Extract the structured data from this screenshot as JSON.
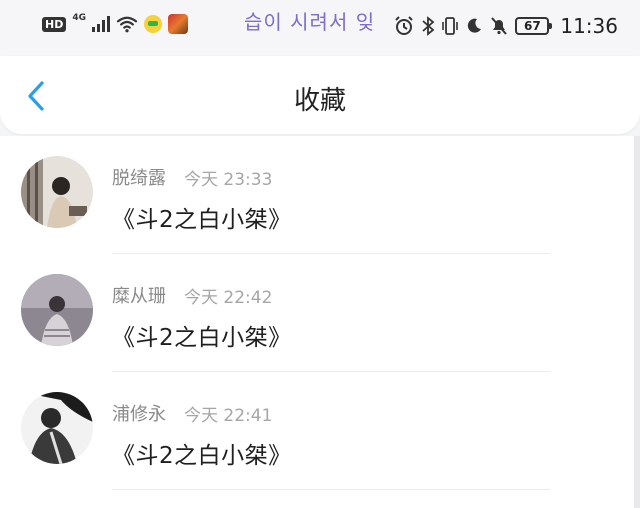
{
  "status_bar": {
    "hd": "HD",
    "network": "4G",
    "overlay_text": "습이 시려서 잊",
    "battery": "67",
    "time": "11:36"
  },
  "header": {
    "title": "收藏",
    "back_icon": "chevron-left-icon"
  },
  "favorites": [
    {
      "name": "脱绮露",
      "time": "今天 23:33",
      "work": "《斗2之白小桀》"
    },
    {
      "name": "糜从珊",
      "time": "今天 22:42",
      "work": "《斗2之白小桀》"
    },
    {
      "name": "浦修永",
      "time": "今天 22:41",
      "work": "《斗2之白小桀》"
    }
  ],
  "colors": {
    "accent": "#2b9fe6",
    "name_text": "#8a8a8a",
    "time_text": "#a6a6a6"
  }
}
